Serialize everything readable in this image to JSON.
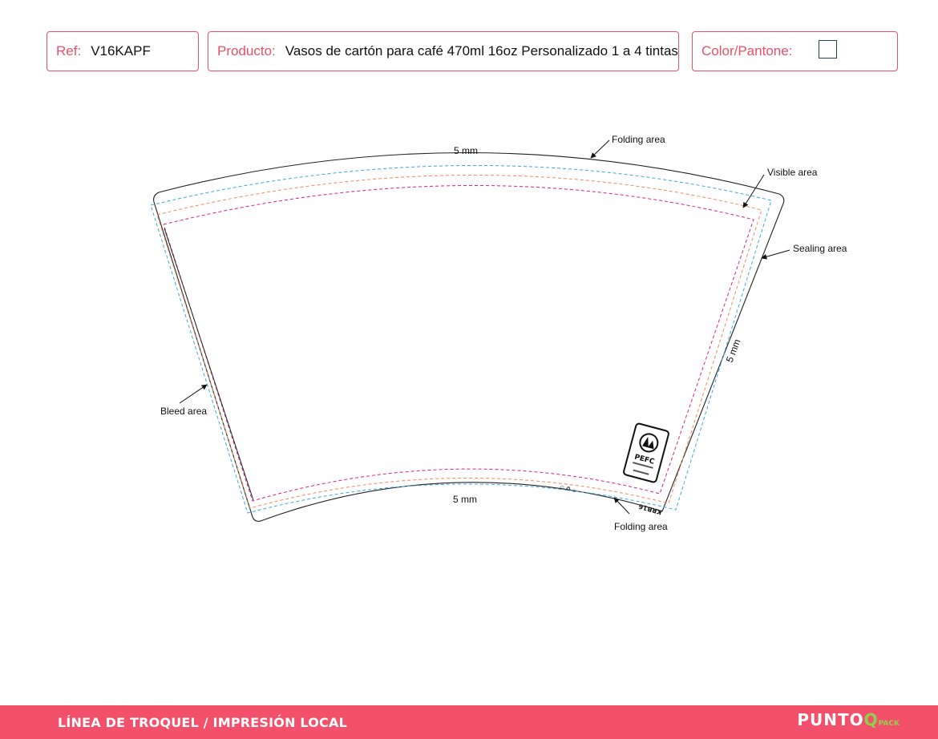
{
  "header": {
    "ref_label": "Ref:",
    "ref_value": "V16KAPF",
    "product_label": "Producto:",
    "product_value": "Vasos de cartón para café 470ml 16oz Personalizado 1 a 4 tintas",
    "color_label": "Color/Pantone:"
  },
  "diagram": {
    "annotations": {
      "folding_top": "Folding area",
      "visible": "Visible area",
      "sealing": "Sealing area",
      "bleed": "Bleed area",
      "folding_bottom": "Folding area"
    },
    "dimensions": {
      "top": "5 mm",
      "bottom": "5 mm",
      "right": "5 mm"
    },
    "cert": {
      "logo": "PEFC",
      "code": "KRB16"
    },
    "colors": {
      "cut_line": "#222222",
      "bleed_line": "#3aa8dc",
      "fold_line": "#f08a5d",
      "visible_line": "#d6237e"
    }
  },
  "footer": {
    "title": "LÍNEA DE TROQUEL / IMPRESIÓN LOCAL",
    "brand_main": "PUNTO",
    "brand_q": "Q",
    "brand_sub": "PACK"
  }
}
